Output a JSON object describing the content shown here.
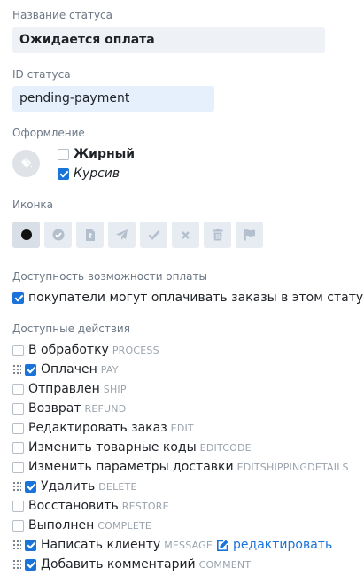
{
  "status_name": {
    "label": "Название статуса",
    "value": "Ожидается оплата"
  },
  "status_id": {
    "label": "ID статуса",
    "value": "pending-payment"
  },
  "appearance": {
    "label": "Оформление",
    "bold": {
      "label": "Жирный",
      "checked": false
    },
    "italic": {
      "label": "Курсив",
      "checked": true
    }
  },
  "icon": {
    "label": "Иконка",
    "options": [
      "circle-icon",
      "check-circle-icon",
      "receipt-icon",
      "paper-plane-icon",
      "check-icon",
      "cross-icon",
      "trash-icon",
      "flag-icon"
    ],
    "selected": "circle-icon"
  },
  "payment": {
    "label": "Доступность возможности оплаты",
    "option": {
      "label": "покупатели могут оплачивать заказы в этом статусе",
      "checked": true
    }
  },
  "actions": {
    "label": "Доступные действия",
    "items": [
      {
        "label": "В обработку",
        "code": "PROCESS",
        "checked": false
      },
      {
        "label": "Оплачен",
        "code": "PAY",
        "checked": true
      },
      {
        "label": "Отправлен",
        "code": "SHIP",
        "checked": false
      },
      {
        "label": "Возврат",
        "code": "REFUND",
        "checked": false
      },
      {
        "label": "Редактировать заказ",
        "code": "EDIT",
        "checked": false
      },
      {
        "label": "Изменить товарные коды",
        "code": "EDITCODE",
        "checked": false
      },
      {
        "label": "Изменить параметры доставки",
        "code": "EDITSHIPPINGDETAILS",
        "checked": false
      },
      {
        "label": "Удалить",
        "code": "DELETE",
        "checked": true
      },
      {
        "label": "Восстановить",
        "code": "RESTORE",
        "checked": false
      },
      {
        "label": "Выполнен",
        "code": "COMPLETE",
        "checked": false
      },
      {
        "label": "Написать клиенту",
        "code": "MESSAGE",
        "checked": true,
        "edit_link": "редактировать"
      },
      {
        "label": "Добавить комментарий",
        "code": "COMMENT",
        "checked": true
      }
    ]
  },
  "colors": {
    "accent": "#1a73d9",
    "field_bg": "#eef1f5",
    "muted": "#9aa3ad"
  }
}
